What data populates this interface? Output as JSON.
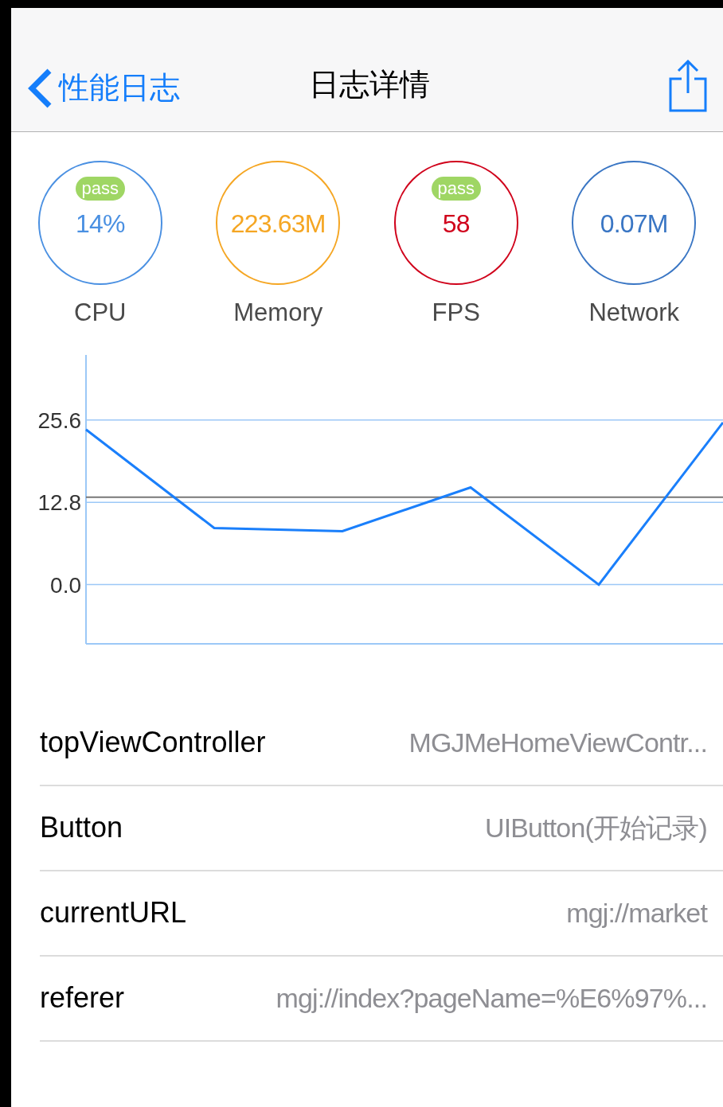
{
  "nav": {
    "back_label": "性能日志",
    "title": "日志详情"
  },
  "metrics": [
    {
      "label": "CPU",
      "value": "14%",
      "badge": "pass",
      "color": "#4a90e2"
    },
    {
      "label": "Memory",
      "value": "223.63M",
      "color": "#f5a623"
    },
    {
      "label": "FPS",
      "value": "58",
      "badge": "pass",
      "color": "#d0021b"
    },
    {
      "label": "Network",
      "value": "0.07M",
      "color": "#3a76c4"
    }
  ],
  "chart_data": {
    "type": "line",
    "ylim": [
      -9.2,
      35.7
    ],
    "yticks": [
      {
        "value": 0,
        "label": "0.0"
      },
      {
        "value": 12.8,
        "label": "12.8"
      },
      {
        "value": 25.6,
        "label": "25.6"
      }
    ],
    "series": [
      {
        "color": "#1a7ffb",
        "values": [
          24.1,
          8.8,
          8.3,
          15.1,
          0,
          25.2
        ]
      }
    ],
    "grid": true,
    "ref_lines": [
      {
        "axis": "y",
        "value": 13.6,
        "color": "#777777"
      }
    ]
  },
  "details": [
    {
      "key": "topViewController",
      "value": "MGJMeHomeViewContr..."
    },
    {
      "key": "Button",
      "value": "UIButton(开始记录)"
    },
    {
      "key": "currentURL",
      "value": "mgj://market"
    },
    {
      "key": "referer",
      "value": "mgj://index?pageName=%E6%97%..."
    }
  ]
}
